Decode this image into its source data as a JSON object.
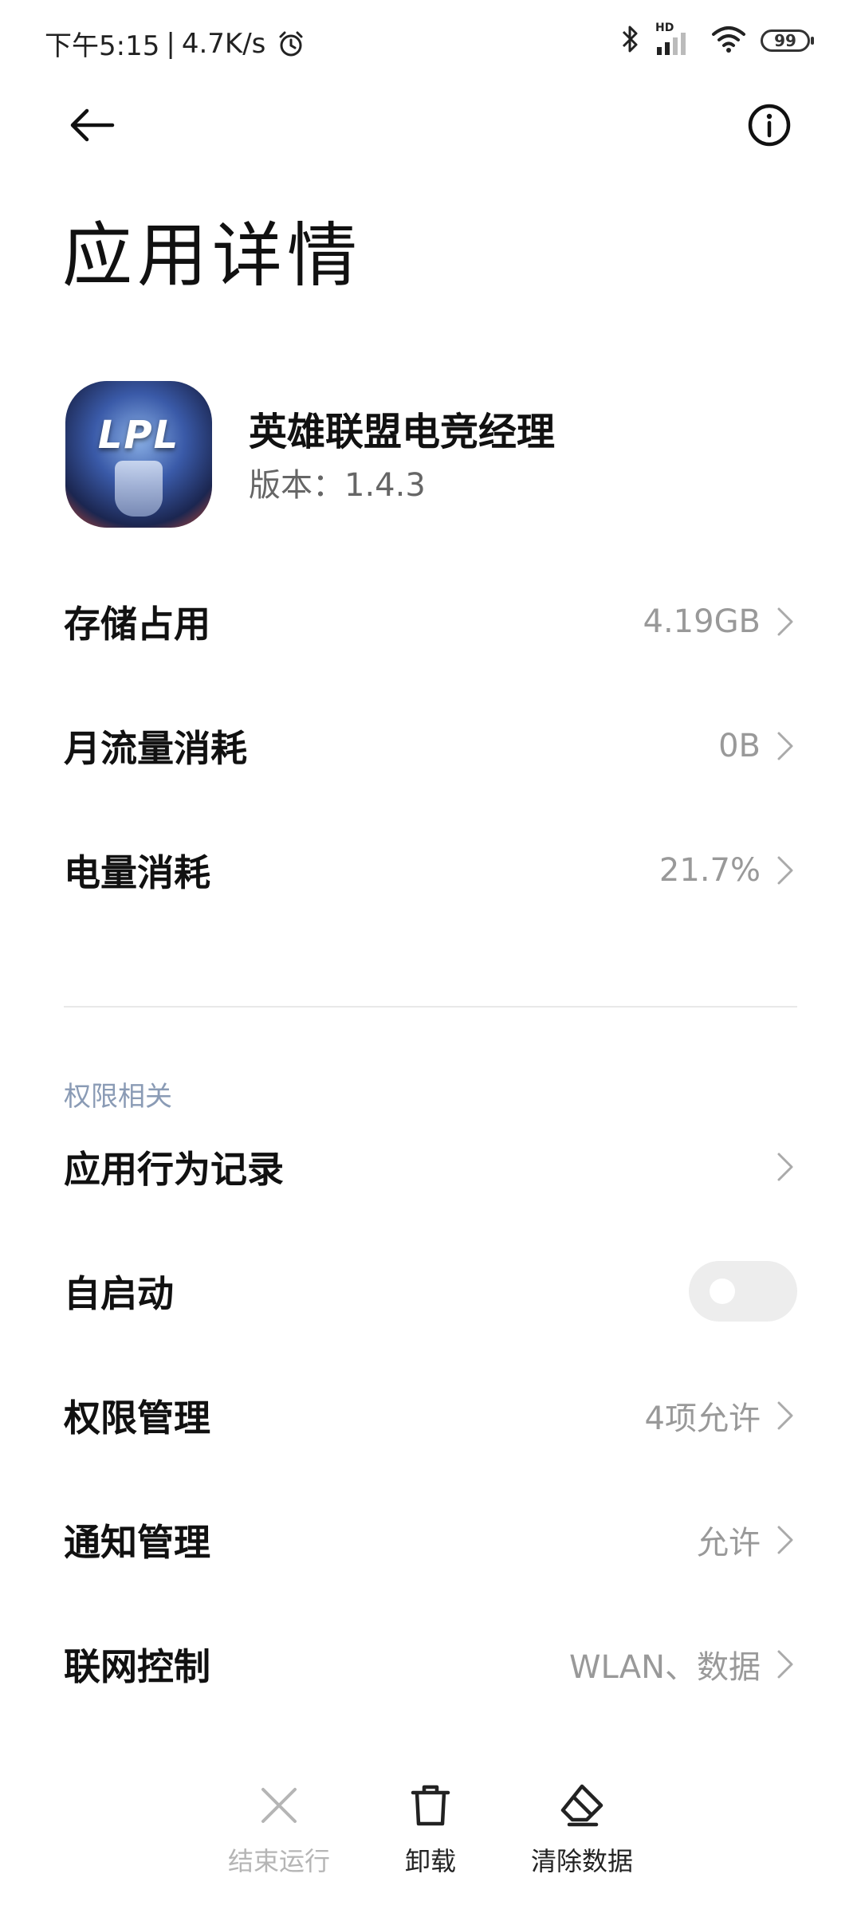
{
  "status_bar": {
    "time": "下午5:15",
    "separator": "|",
    "net_speed": "4.7K/s",
    "alarm_icon": "alarm-clock-icon",
    "bluetooth_icon": "bluetooth-icon",
    "signal_label": "HD",
    "signal_icon": "cell-signal-icon",
    "wifi_icon": "wifi-icon",
    "battery": "99"
  },
  "nav": {
    "back_icon": "arrow-left-icon",
    "info_icon": "info-circle-icon"
  },
  "page": {
    "title": "应用详情"
  },
  "app": {
    "icon_text": "LPL",
    "name": "英雄联盟电竞经理",
    "version": "版本：1.4.3"
  },
  "usage_rows": [
    {
      "label": "存储占用",
      "value": "4.19GB"
    },
    {
      "label": "月流量消耗",
      "value": "0B"
    },
    {
      "label": "电量消耗",
      "value": "21.7%"
    }
  ],
  "permissions": {
    "section_title": "权限相关",
    "rows": [
      {
        "label": "应用行为记录",
        "value": ""
      },
      {
        "label": "自启动",
        "toggle": false
      },
      {
        "label": "权限管理",
        "value": "4项允许"
      },
      {
        "label": "通知管理",
        "value": "允许"
      },
      {
        "label": "联网控制",
        "value": "WLAN、数据"
      }
    ]
  },
  "actions": {
    "stop": {
      "label": "结束运行",
      "icon": "close-x-icon",
      "enabled": false
    },
    "uninstall": {
      "label": "卸载",
      "icon": "trash-icon"
    },
    "clear": {
      "label": "清除数据",
      "icon": "eraser-icon"
    }
  },
  "colors": {
    "text_primary": "#111111",
    "text_secondary": "#999999",
    "section_header": "#8a9bb5",
    "disabled": "#b5b5b5",
    "toggle_off": "#ededed"
  }
}
